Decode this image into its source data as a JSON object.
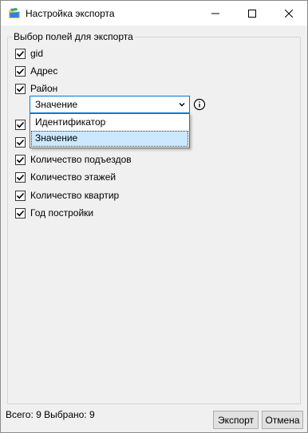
{
  "window": {
    "title": "Настройка экспорта",
    "icon": "folder-app-icon",
    "controls": [
      "minimize-icon",
      "maximize-icon",
      "close-icon"
    ]
  },
  "group": {
    "title": "Выбор полей для экспорта"
  },
  "fields": [
    {
      "label": "gid",
      "checked": true
    },
    {
      "label": "Адрес",
      "checked": true
    },
    {
      "label": "Район",
      "checked": true
    },
    {
      "label": "",
      "checked": true
    },
    {
      "label": "",
      "checked": true
    },
    {
      "label": "Количество подъездов",
      "checked": true
    },
    {
      "label": "Количество этажей",
      "checked": true
    },
    {
      "label": "Количество квартир",
      "checked": true
    },
    {
      "label": "Год постройки",
      "checked": true
    }
  ],
  "combo": {
    "selected": "Значение",
    "options": [
      "Идентификатор",
      "Значение"
    ],
    "highlighted_index": 1
  },
  "status": {
    "text": "Всего: 9 Выбрано: 9"
  },
  "buttons": {
    "export": "Экспорт",
    "cancel": "Отмена"
  },
  "colors": {
    "accent": "#0078d7",
    "highlight": "#cce8ff",
    "icon_yellow": "#f2c94c",
    "icon_blue": "#2f80ed"
  }
}
